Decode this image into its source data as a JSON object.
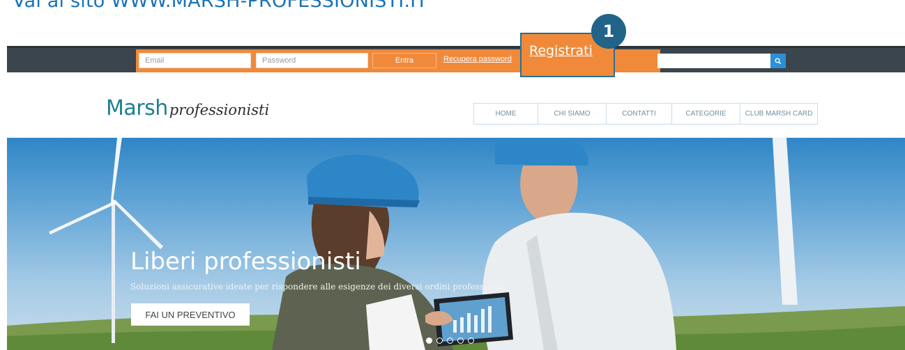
{
  "instruction": {
    "text": "Vai al sito WWW.MARSH-PROFESSIONISTI.IT"
  },
  "topbar": {
    "email_placeholder": "Email",
    "password_placeholder": "Password",
    "entra_label": "Entra",
    "recupera_label": "Recupera password",
    "registrati_label": "Registrati",
    "callout_number": "1",
    "search_icon": "search-icon"
  },
  "header": {
    "logo_main": "Marsh",
    "logo_sub": "professionisti",
    "nav": [
      {
        "label": "HOME"
      },
      {
        "label": "CHI SIAMO"
      },
      {
        "label": "CONTATTI"
      },
      {
        "label": "CATEGORIE"
      },
      {
        "label": "CLUB MARSH CARD"
      }
    ]
  },
  "hero": {
    "title": "Liberi professionisti",
    "subtitle": "Soluzioni assicurative ideate per rispondere alle esigenze dei diversi ordini professionali.",
    "cta_label": "FAI UN PREVENTIVO",
    "slides": 5,
    "active_slide": 1
  },
  "colors": {
    "orange": "#f08a3a",
    "dark_bar": "#3b454d",
    "brand_teal": "#1f7f93",
    "callout_blue": "#216389",
    "link_blue": "#1a73b8",
    "search_blue": "#2d8fd5"
  }
}
